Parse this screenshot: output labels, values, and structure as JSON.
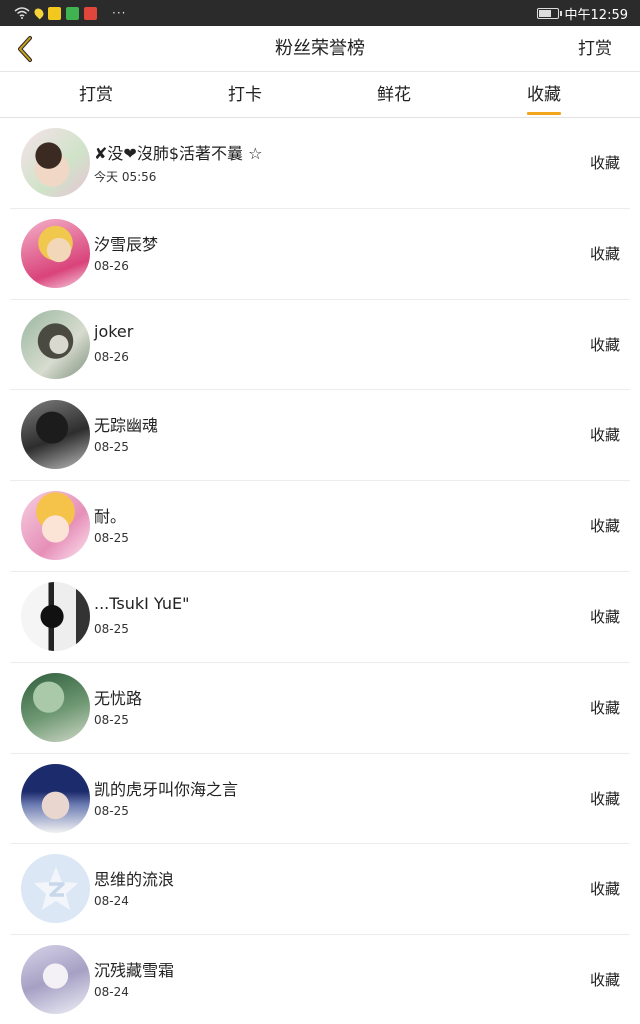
{
  "status_bar": {
    "time": "中午12:59",
    "more": "···"
  },
  "header": {
    "title": "粉丝荣誉榜",
    "right_action": "打赏",
    "back_icon": "chevron-left-icon",
    "accent_color": "#f3a51d"
  },
  "tabs": [
    {
      "label": "打赏",
      "active": false
    },
    {
      "label": "打卡",
      "active": false
    },
    {
      "label": "鲜花",
      "active": false
    },
    {
      "label": "收藏",
      "active": true
    }
  ],
  "fans": [
    {
      "name": "✘没❤沒肺$活著不曩 ☆",
      "date": "今天 05:56",
      "action": "收藏"
    },
    {
      "name": "汐雪辰梦",
      "date": "08-26",
      "action": "收藏"
    },
    {
      "name": "joker",
      "date": "08-26",
      "action": "收藏"
    },
    {
      "name": "无踪幽魂",
      "date": "08-25",
      "action": "收藏"
    },
    {
      "name": "耐。",
      "date": "08-25",
      "action": "收藏"
    },
    {
      "name": "...TsukI YuE\"",
      "date": "08-25",
      "action": "收藏"
    },
    {
      "name": "无忧路",
      "date": "08-25",
      "action": "收藏"
    },
    {
      "name": "凯的虎牙叫你海之言",
      "date": "08-25",
      "action": "收藏"
    },
    {
      "name": "思维的流浪",
      "date": "08-24",
      "action": "收藏"
    },
    {
      "name": "沉残藏雪霜",
      "date": "08-24",
      "action": "收藏"
    }
  ]
}
